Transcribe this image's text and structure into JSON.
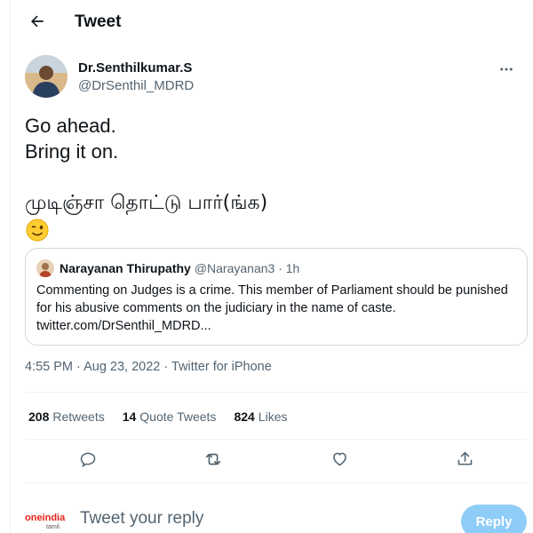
{
  "header": {
    "title": "Tweet",
    "back_icon": "arrow-left-icon"
  },
  "author": {
    "name": "Dr.Senthilkumar.S",
    "handle": "@DrSenthil_MDRD",
    "more_icon": "more-horizontal-icon"
  },
  "tweet": {
    "lines": [
      "Go ahead.",
      "Bring it on.",
      "",
      "முடிஞ்சா தொட்டு பார்(ங்க)"
    ],
    "emoji": "winking-face-emoji"
  },
  "quote": {
    "name": "Narayanan Thirupathy",
    "handle": "@Narayanan3 · 1h",
    "text": "Commenting on Judges is a crime. This member of Parliament should be punished for his abusive comments on the judiciary in the name of caste. twitter.com/DrSenthil_MDRD..."
  },
  "meta": {
    "text": "4:55 PM · Aug 23, 2022 · Twitter for iPhone"
  },
  "stats": [
    {
      "count": "208",
      "label": "Retweets"
    },
    {
      "count": "14",
      "label": "Quote Tweets"
    },
    {
      "count": "824",
      "label": "Likes"
    }
  ],
  "actions": [
    {
      "name": "reply-icon"
    },
    {
      "name": "retweet-icon"
    },
    {
      "name": "like-icon"
    },
    {
      "name": "share-icon"
    }
  ],
  "reply": {
    "logo_text": "oneindia",
    "logo_sub": "tamil",
    "placeholder": "Tweet your reply",
    "button_label": "Reply"
  },
  "colors": {
    "text": "#0f1419",
    "secondary": "#536471",
    "border": "#cfd9de",
    "reply_button": "#8ecdf8",
    "logo": "#e2231a"
  }
}
